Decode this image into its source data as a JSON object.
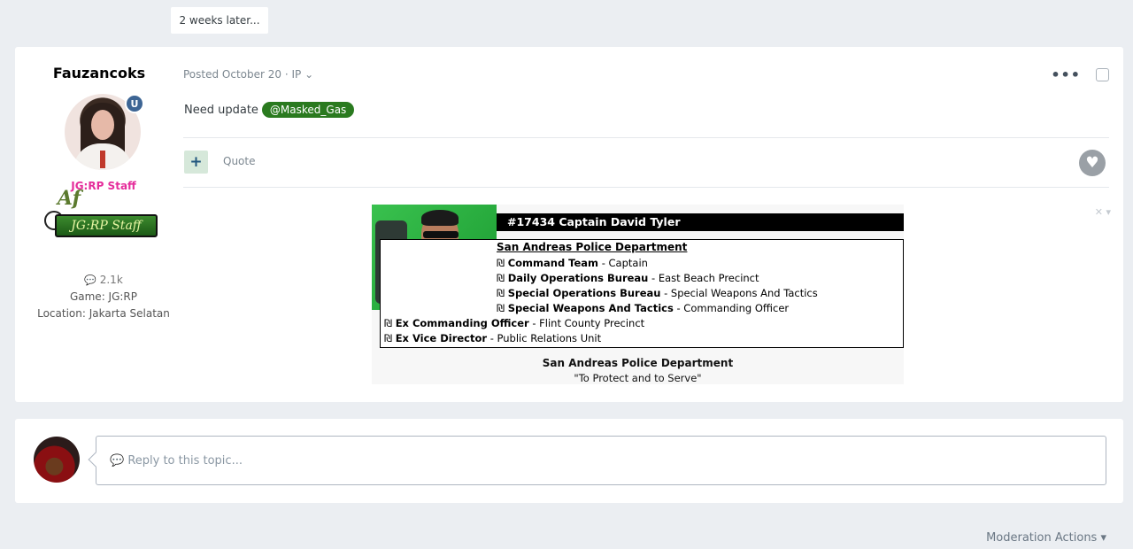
{
  "time_gap": "2 weeks later...",
  "post": {
    "author": {
      "name": "Fauzancoks",
      "group": "JG:RP Staff",
      "mod_badge_icon": "shield-icon",
      "rank_badge_text": "Af",
      "staff_banner_text": "JG:RP Staff",
      "post_count": "2.1k",
      "game": "Game: JG:RP",
      "location": "Location: Jakarta Selatan"
    },
    "meta": "Posted October 20 · IP",
    "tools_icon": "ellipsis-icon",
    "body_text": "Need update",
    "mention": "@Masked_Gas",
    "rep_icon": "plus-icon",
    "quote_label": "Quote",
    "like_icon": "heart-icon",
    "signature": {
      "title": "#17434 Captain David Tyler",
      "department": "San Andreas Police Department",
      "lines": [
        {
          "bold": "Command Team",
          "rest": " - Captain"
        },
        {
          "bold": "Daily Operations Bureau",
          "rest": " - East Beach Precinct"
        },
        {
          "bold": "Special Operations Bureau",
          "rest": " - Special Weapons And Tactics"
        },
        {
          "bold": "Special Weapons And Tactics",
          "rest": " - Commanding Officer"
        },
        {
          "bold": "Ex Commanding Officer",
          "rest": " - Flint County Precinct"
        },
        {
          "bold": "Ex Vice Director",
          "rest": " - Public Relations Unit"
        }
      ],
      "bullet": "₪",
      "footer_name": "San Andreas Police Department",
      "footer_motto": "\"To Protect and to Serve\""
    }
  },
  "reply": {
    "placeholder": "Reply to this topic..."
  },
  "moderation_actions": "Moderation Actions ▾",
  "colors": {
    "page_bg": "#ebeef2",
    "group_color": "#e52d9b",
    "mention_bg": "#2a7a1f",
    "rep_bg": "#d6e8da"
  }
}
